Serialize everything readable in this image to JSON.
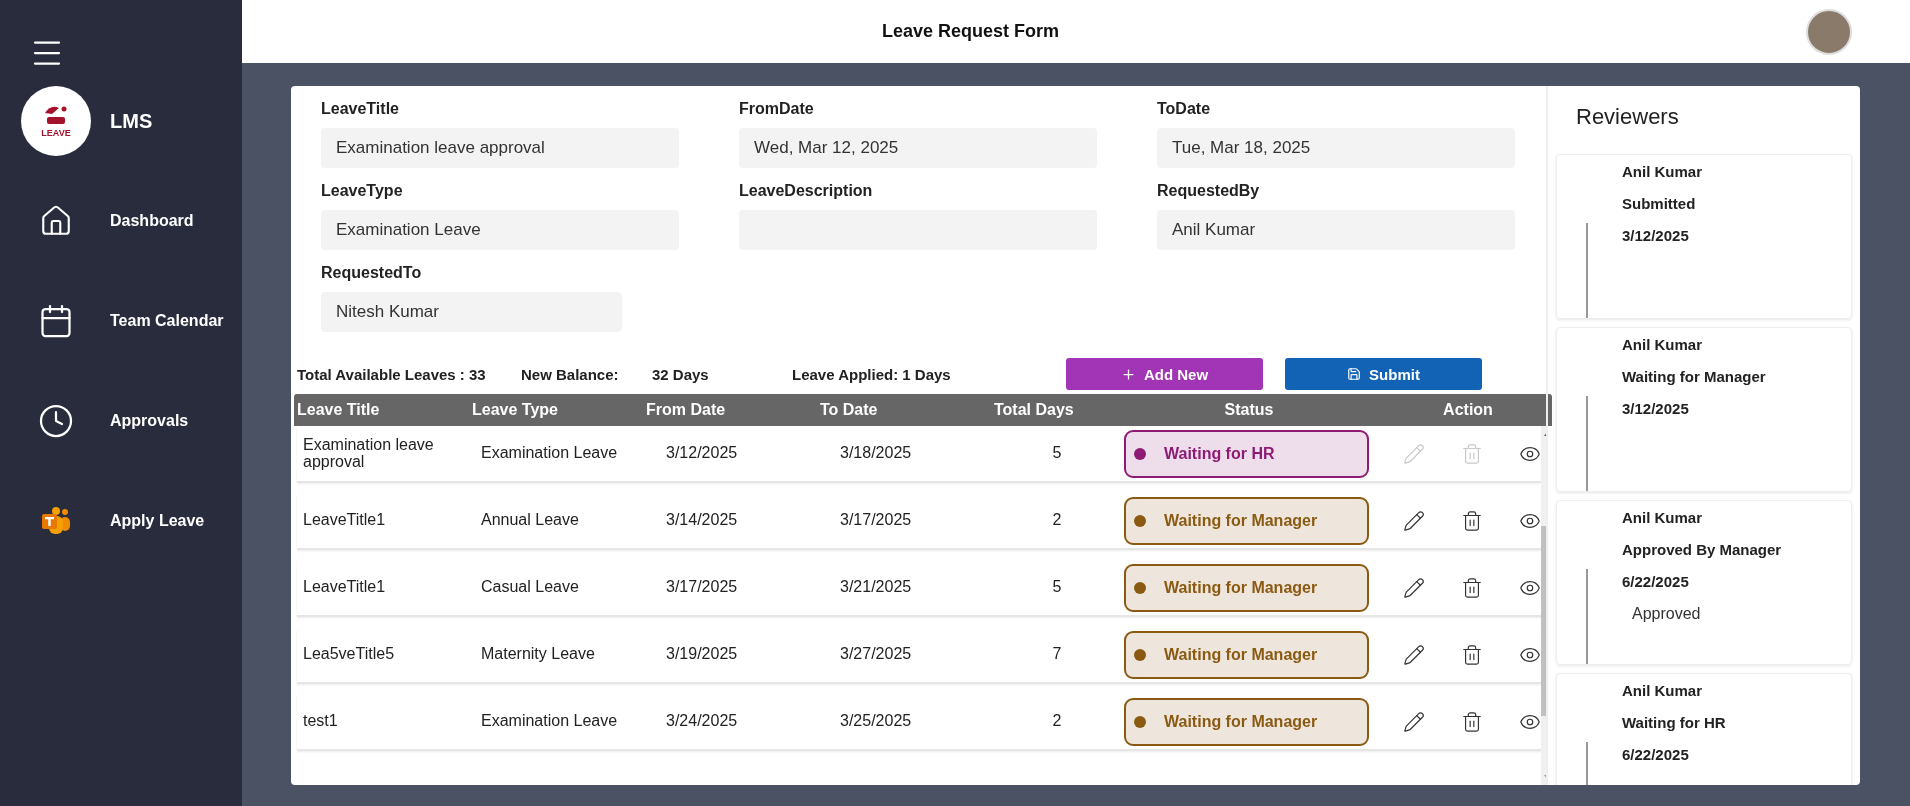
{
  "sidebar": {
    "logo_caption": "LEAVE",
    "app_name": "LMS",
    "items": [
      {
        "label": "Dashboard",
        "kind": "home"
      },
      {
        "label": "Team Calendar",
        "kind": "calendar"
      },
      {
        "label": "Approvals",
        "kind": "clock"
      },
      {
        "label": "Apply Leave",
        "kind": "teams"
      }
    ]
  },
  "header": {
    "title": "Leave Request Form"
  },
  "form": {
    "fields": [
      {
        "label": "LeaveTitle",
        "value": "Examination leave approval"
      },
      {
        "label": "FromDate",
        "value": "Wed, Mar 12, 2025"
      },
      {
        "label": "ToDate",
        "value": "Tue, Mar 18, 2025"
      },
      {
        "label": "LeaveType",
        "value": "Examination Leave"
      },
      {
        "label": "LeaveDescription"
      },
      {
        "label": "RequestedBy",
        "value": "Anil Kumar"
      },
      {
        "label": "RequestedTo",
        "value": "Nitesh Kumar"
      }
    ]
  },
  "summary": {
    "available": "Total Available Leaves : 33",
    "balance_label": "New Balance:",
    "balance_value": "32 Days",
    "applied": "Leave Applied: 1 Days"
  },
  "buttons": [
    {
      "label": "Add New",
      "kind": "add"
    },
    {
      "label": "Submit",
      "kind": "submit"
    }
  ],
  "table": {
    "columns": [
      "Leave Title",
      "Leave Type",
      "From Date",
      "To Date",
      "Total Days",
      "Status",
      "Action"
    ],
    "rows": [
      {
        "cells": [
          "Examination leave approval",
          "Examination Leave",
          "3/12/2025",
          "3/18/2025",
          "5"
        ],
        "status": "Waiting for HR",
        "color": "#8e1b74",
        "actions_disabled": true
      },
      {
        "cells": [
          "LeaveTitle1",
          "Annual Leave",
          "3/14/2025",
          "3/17/2025",
          "2"
        ],
        "status": "Waiting for Manager",
        "color": "#8a5a12",
        "actions_disabled": false
      },
      {
        "cells": [
          "LeaveTitle1",
          "Casual Leave",
          "3/17/2025",
          "3/21/2025",
          "5"
        ],
        "status": "Waiting for Manager",
        "color": "#8a5a12",
        "actions_disabled": false
      },
      {
        "cells": [
          "Lea5veTitle5",
          "Maternity Leave",
          "3/19/2025",
          "3/27/2025",
          "7"
        ],
        "status": "Waiting for Manager",
        "color": "#8a5a12",
        "actions_disabled": false
      },
      {
        "cells": [
          "test1",
          "Examination Leave",
          "3/24/2025",
          "3/25/2025",
          "2"
        ],
        "status": "Waiting for Manager",
        "color": "#8a5a12",
        "actions_disabled": false
      }
    ]
  },
  "reviewers": {
    "title": "Reviewers",
    "items": [
      {
        "name": "Anil Kumar",
        "status": "Submitted",
        "date": "3/12/2025"
      },
      {
        "name": "Anil Kumar",
        "status": "Waiting for Manager",
        "date": "3/12/2025"
      },
      {
        "name": "Anil Kumar",
        "status": "Approved By Manager",
        "date": "6/22/2025",
        "comment": "Approved"
      },
      {
        "name": "Anil Kumar",
        "status": "Waiting for HR",
        "date": "6/22/2025"
      }
    ]
  }
}
